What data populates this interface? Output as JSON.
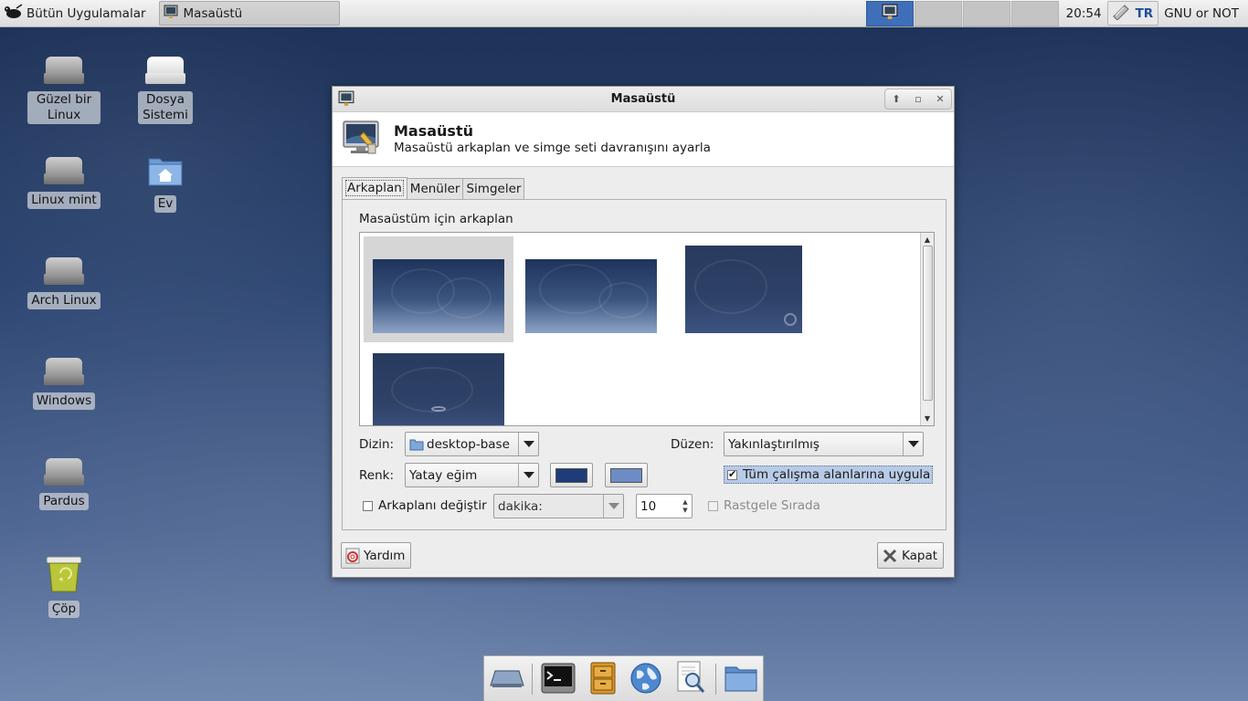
{
  "panel": {
    "apps_menu_label": "Bütün Uygulamalar",
    "task_label": "Masaüstü",
    "clock": "20:54",
    "keyboard_layout": "TR",
    "user_label": "GNU or NOT"
  },
  "desktop_icons": [
    {
      "label": "Güzel bir Linux"
    },
    {
      "label": "Dosya Sistemi"
    },
    {
      "label": "Linux mint"
    },
    {
      "label": "Ev"
    },
    {
      "label": "Arch Linux"
    },
    {
      "label": "Windows"
    },
    {
      "label": "Pardus"
    },
    {
      "label": "Çöp"
    }
  ],
  "dialog": {
    "window_title": "Masaüstü",
    "header_title": "Masaüstü",
    "header_subtitle": "Masaüstü arkaplan ve simge seti davranışını ayarla",
    "tabs": [
      {
        "label": "Arkaplan",
        "active": true
      },
      {
        "label": "Menüler",
        "active": false
      },
      {
        "label": "Simgeler",
        "active": false
      }
    ],
    "section_label": "Masaüstüm için arkaplan",
    "directory_label": "Dizin:",
    "directory_value": "desktop-base",
    "layout_label": "Düzen:",
    "layout_value": "Yakınlaştırılmış",
    "color_label": "Renk:",
    "color_mode_value": "Yatay eğim",
    "color_primary": "#1f3c78",
    "color_secondary": "#6d8cc6",
    "apply_all_label": "Tüm çalışma alanlarına uygula",
    "apply_all_checked": true,
    "change_bg_label": "Arkaplanı değiştir",
    "change_bg_checked": false,
    "interval_unit_value": "dakika:",
    "interval_value": "10",
    "random_order_label": "Rastgele Sırada",
    "random_order_checked": false,
    "help_button": "Yardım",
    "close_button": "Kapat"
  }
}
